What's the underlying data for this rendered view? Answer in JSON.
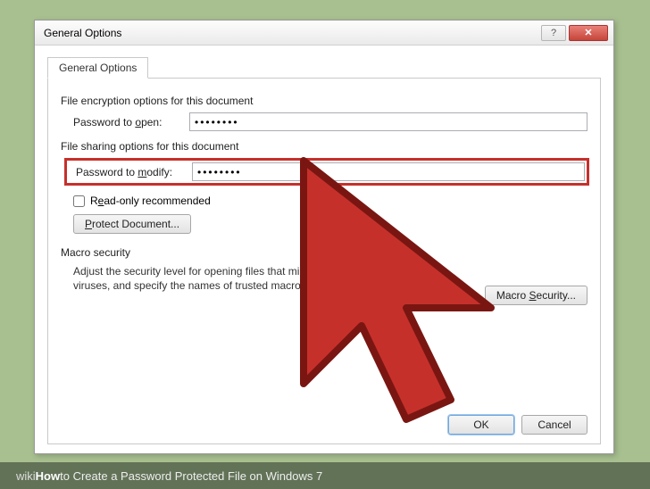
{
  "dialog": {
    "title": "General Options",
    "tab_label": "General Options",
    "encryption_group": "File encryption options for this document",
    "open_label_pre": "Password to ",
    "open_label_u": "o",
    "open_label_post": "pen:",
    "open_value": "••••••••",
    "sharing_group": "File sharing options for this document",
    "modify_label_pre": "Password to ",
    "modify_label_u": "m",
    "modify_label_post": "odify:",
    "modify_value": "••••••••",
    "readonly_pre": "R",
    "readonly_u": "e",
    "readonly_post": "ad-only recommended",
    "protect_btn_u": "P",
    "protect_btn_post": "rotect Document...",
    "macro_group": "Macro security",
    "macro_desc": "Adjust the security level for opening files that might contain macro viruses, and specify the names of trusted macro developers.",
    "macro_btn_pre": "Macro ",
    "macro_btn_u": "S",
    "macro_btn_post": "ecurity...",
    "ok": "OK",
    "cancel": "Cancel",
    "help": "?",
    "close": "✕"
  },
  "caption": {
    "wiki": "wiki",
    "how": "How",
    "rest": " to Create a Password Protected File on Windows 7"
  }
}
